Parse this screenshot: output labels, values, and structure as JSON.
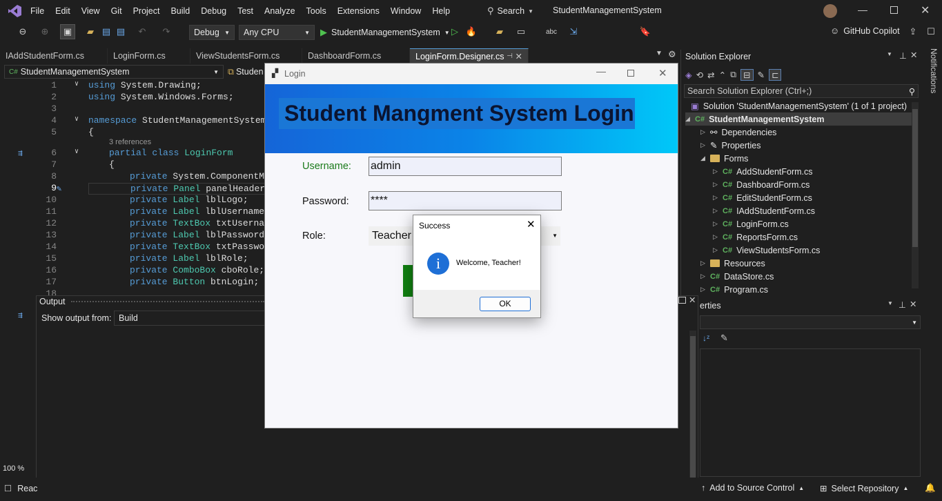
{
  "menu": [
    "File",
    "Edit",
    "View",
    "Git",
    "Project",
    "Build",
    "Debug",
    "Test",
    "Analyze",
    "Tools",
    "Extensions",
    "Window",
    "Help"
  ],
  "search_label": "Search",
  "solution_title": "StudentManagementSystem",
  "toolbar": {
    "config": "Debug",
    "platform": "Any CPU",
    "run_target": "StudentManagementSystem",
    "copilot": "GitHub Copilot"
  },
  "tabs": [
    "IAddStudentForm.cs",
    "LoginForm.cs",
    "ViewStudentsForm.cs",
    "DashboardForm.cs",
    "LoginForm.Designer.cs"
  ],
  "editor": {
    "project_combo": "StudentManagementSystem",
    "member_combo": "Studen",
    "references": "3 references",
    "lines": [
      "1",
      "2",
      "3",
      "4",
      "5",
      "",
      "6",
      "7",
      "8",
      "9",
      "10",
      "11",
      "12",
      "13",
      "14",
      "15",
      "16",
      "17",
      "18"
    ]
  },
  "login": {
    "title": "Login",
    "banner": "Student Mangment System Login",
    "username_label": "Username:",
    "username_value": "admin",
    "password_label": "Password:",
    "password_value": "****",
    "role_label": "Role:",
    "role_value": "Teacher"
  },
  "dialog": {
    "title": "Success",
    "message": "Welcome, Teacher!",
    "ok": "OK"
  },
  "output": {
    "title": "Output",
    "show_from": "Show output from:",
    "source": "Build"
  },
  "solution_explorer": {
    "title": "Solution Explorer",
    "search": "Search Solution Explorer (Ctrl+;)",
    "solution": "Solution 'StudentManagementSystem' (1 of 1 project)",
    "project": "StudentManagementSystem",
    "items": [
      "Dependencies",
      "Properties",
      "Forms",
      "AddStudentForm.cs",
      "DashboardForm.cs",
      "EditStudentForm.cs",
      "IAddStudentForm.cs",
      "LoginForm.cs",
      "ReportsForm.cs",
      "ViewStudentsForm.cs",
      "Resources",
      "DataStore.cs",
      "Program.cs"
    ]
  },
  "properties": {
    "title": "erties"
  },
  "notifications": "Notifications",
  "status": {
    "zoom": "100 %",
    "ready": "Reac",
    "source_control": "Add to Source Control",
    "repo": "Select Repository"
  }
}
